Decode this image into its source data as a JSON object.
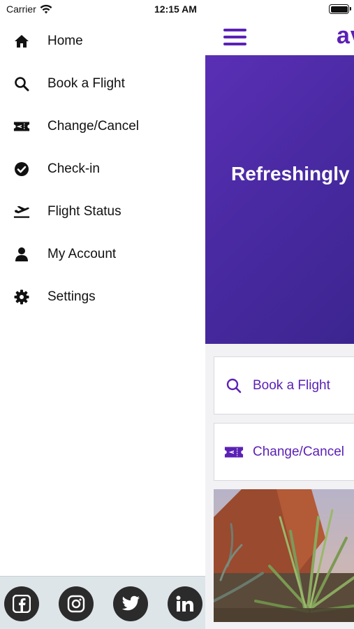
{
  "status_bar": {
    "carrier": "Carrier",
    "time": "12:15 AM"
  },
  "drawer": {
    "items": [
      {
        "label": "Home",
        "icon": "home-icon"
      },
      {
        "label": "Book a Flight",
        "icon": "search-icon"
      },
      {
        "label": "Change/Cancel",
        "icon": "ticket-icon"
      },
      {
        "label": "Check-in",
        "icon": "check-circle-icon"
      },
      {
        "label": "Flight Status",
        "icon": "plane-departure-icon"
      },
      {
        "label": "My Account",
        "icon": "user-icon"
      },
      {
        "label": "Settings",
        "icon": "gear-icon"
      }
    ],
    "social": [
      "facebook-icon",
      "instagram-icon",
      "twitter-icon",
      "linkedin-icon"
    ]
  },
  "main": {
    "logo": "av",
    "hero_text": "Refreshingly",
    "cards": [
      {
        "label": "Book a Flight",
        "icon": "search-icon"
      },
      {
        "label": "Change/Cancel",
        "icon": "ticket-icon"
      }
    ]
  },
  "colors": {
    "accent": "#5b21b6",
    "hero_start": "#5a2fb5",
    "hero_end": "#3c2590",
    "social_bar": "#dde5e9",
    "social_button": "#2b2b2b"
  }
}
